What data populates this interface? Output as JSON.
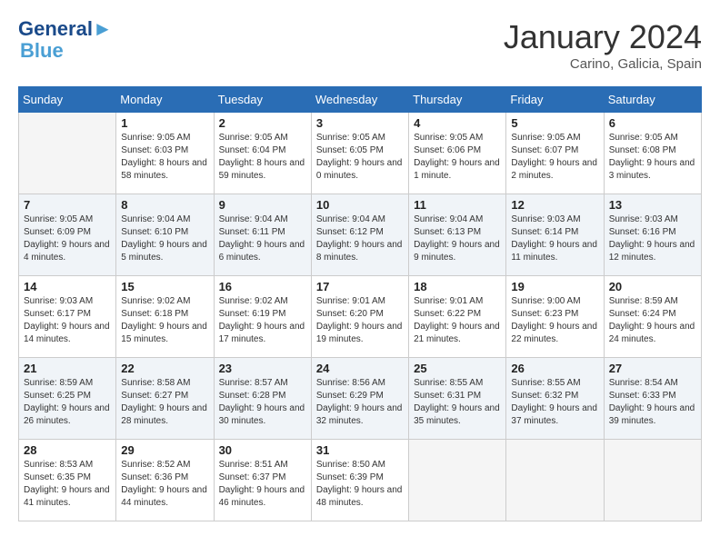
{
  "header": {
    "logo_line1": "General",
    "logo_line2": "Blue",
    "month": "January 2024",
    "location": "Carino, Galicia, Spain"
  },
  "weekdays": [
    "Sunday",
    "Monday",
    "Tuesday",
    "Wednesday",
    "Thursday",
    "Friday",
    "Saturday"
  ],
  "weeks": [
    [
      {
        "day": "",
        "empty": true
      },
      {
        "day": "1",
        "sunrise": "9:05 AM",
        "sunset": "6:03 PM",
        "daylight": "8 hours and 58 minutes."
      },
      {
        "day": "2",
        "sunrise": "9:05 AM",
        "sunset": "6:04 PM",
        "daylight": "8 hours and 59 minutes."
      },
      {
        "day": "3",
        "sunrise": "9:05 AM",
        "sunset": "6:05 PM",
        "daylight": "9 hours and 0 minutes."
      },
      {
        "day": "4",
        "sunrise": "9:05 AM",
        "sunset": "6:06 PM",
        "daylight": "9 hours and 1 minute."
      },
      {
        "day": "5",
        "sunrise": "9:05 AM",
        "sunset": "6:07 PM",
        "daylight": "9 hours and 2 minutes."
      },
      {
        "day": "6",
        "sunrise": "9:05 AM",
        "sunset": "6:08 PM",
        "daylight": "9 hours and 3 minutes."
      }
    ],
    [
      {
        "day": "7",
        "sunrise": "9:05 AM",
        "sunset": "6:09 PM",
        "daylight": "9 hours and 4 minutes."
      },
      {
        "day": "8",
        "sunrise": "9:04 AM",
        "sunset": "6:10 PM",
        "daylight": "9 hours and 5 minutes."
      },
      {
        "day": "9",
        "sunrise": "9:04 AM",
        "sunset": "6:11 PM",
        "daylight": "9 hours and 6 minutes."
      },
      {
        "day": "10",
        "sunrise": "9:04 AM",
        "sunset": "6:12 PM",
        "daylight": "9 hours and 8 minutes."
      },
      {
        "day": "11",
        "sunrise": "9:04 AM",
        "sunset": "6:13 PM",
        "daylight": "9 hours and 9 minutes."
      },
      {
        "day": "12",
        "sunrise": "9:03 AM",
        "sunset": "6:14 PM",
        "daylight": "9 hours and 11 minutes."
      },
      {
        "day": "13",
        "sunrise": "9:03 AM",
        "sunset": "6:16 PM",
        "daylight": "9 hours and 12 minutes."
      }
    ],
    [
      {
        "day": "14",
        "sunrise": "9:03 AM",
        "sunset": "6:17 PM",
        "daylight": "9 hours and 14 minutes."
      },
      {
        "day": "15",
        "sunrise": "9:02 AM",
        "sunset": "6:18 PM",
        "daylight": "9 hours and 15 minutes."
      },
      {
        "day": "16",
        "sunrise": "9:02 AM",
        "sunset": "6:19 PM",
        "daylight": "9 hours and 17 minutes."
      },
      {
        "day": "17",
        "sunrise": "9:01 AM",
        "sunset": "6:20 PM",
        "daylight": "9 hours and 19 minutes."
      },
      {
        "day": "18",
        "sunrise": "9:01 AM",
        "sunset": "6:22 PM",
        "daylight": "9 hours and 21 minutes."
      },
      {
        "day": "19",
        "sunrise": "9:00 AM",
        "sunset": "6:23 PM",
        "daylight": "9 hours and 22 minutes."
      },
      {
        "day": "20",
        "sunrise": "8:59 AM",
        "sunset": "6:24 PM",
        "daylight": "9 hours and 24 minutes."
      }
    ],
    [
      {
        "day": "21",
        "sunrise": "8:59 AM",
        "sunset": "6:25 PM",
        "daylight": "9 hours and 26 minutes."
      },
      {
        "day": "22",
        "sunrise": "8:58 AM",
        "sunset": "6:27 PM",
        "daylight": "9 hours and 28 minutes."
      },
      {
        "day": "23",
        "sunrise": "8:57 AM",
        "sunset": "6:28 PM",
        "daylight": "9 hours and 30 minutes."
      },
      {
        "day": "24",
        "sunrise": "8:56 AM",
        "sunset": "6:29 PM",
        "daylight": "9 hours and 32 minutes."
      },
      {
        "day": "25",
        "sunrise": "8:55 AM",
        "sunset": "6:31 PM",
        "daylight": "9 hours and 35 minutes."
      },
      {
        "day": "26",
        "sunrise": "8:55 AM",
        "sunset": "6:32 PM",
        "daylight": "9 hours and 37 minutes."
      },
      {
        "day": "27",
        "sunrise": "8:54 AM",
        "sunset": "6:33 PM",
        "daylight": "9 hours and 39 minutes."
      }
    ],
    [
      {
        "day": "28",
        "sunrise": "8:53 AM",
        "sunset": "6:35 PM",
        "daylight": "9 hours and 41 minutes."
      },
      {
        "day": "29",
        "sunrise": "8:52 AM",
        "sunset": "6:36 PM",
        "daylight": "9 hours and 44 minutes."
      },
      {
        "day": "30",
        "sunrise": "8:51 AM",
        "sunset": "6:37 PM",
        "daylight": "9 hours and 46 minutes."
      },
      {
        "day": "31",
        "sunrise": "8:50 AM",
        "sunset": "6:39 PM",
        "daylight": "9 hours and 48 minutes."
      },
      {
        "day": "",
        "empty": true
      },
      {
        "day": "",
        "empty": true
      },
      {
        "day": "",
        "empty": true
      }
    ]
  ]
}
